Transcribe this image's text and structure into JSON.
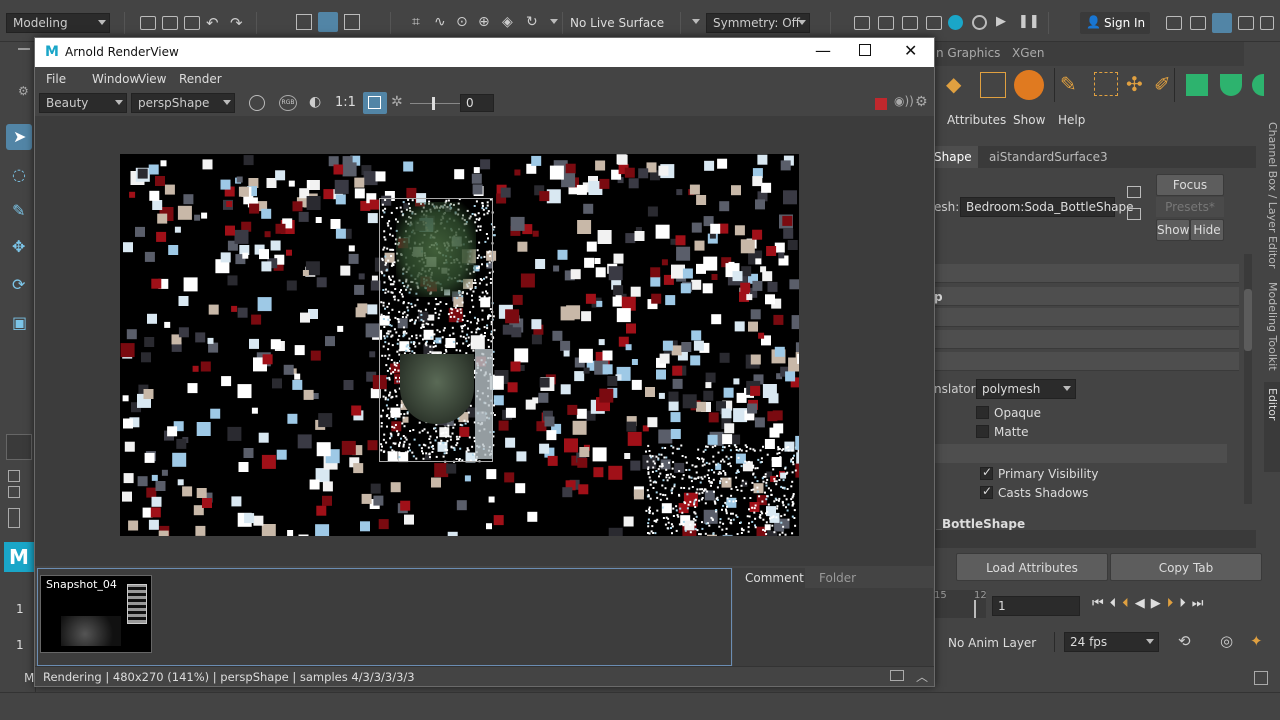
{
  "topbar": {
    "menu_set": "Modeling",
    "live_surface": "No Live Surface",
    "symmetry": "Symmetry: Off",
    "sign_in": "Sign In"
  },
  "arnold": {
    "title": "Arnold RenderView",
    "menu": [
      "File",
      "Window",
      "View",
      "Render"
    ],
    "aov": "Beauty",
    "camera": "perspShape",
    "ratio": "1:1",
    "exposure": "0",
    "snapshot_label": "Snapshot_04",
    "tabs": [
      "Comment",
      "Folder"
    ],
    "status": "Rendering | 480x270 (141%) | perspShape  | samples 4/3/3/3/3/3"
  },
  "right": {
    "tab_partial_1": "n Graphics",
    "tab_xgen": "XGen",
    "menu": [
      "Attributes",
      "Show",
      "Help"
    ],
    "node_tab_1": "Shape",
    "node_tab_2": "aiStandardSurface3",
    "mesh_label": "esh:",
    "mesh_value": "Bedroom:Soda_BottleShape",
    "focus": "Focus",
    "presets": "Presets*",
    "show": "Show",
    "hide": "Hide",
    "section_p": "p",
    "translator_label": "nslator",
    "translator_value": "polymesh",
    "opaque": "Opaque",
    "matte": "Matte",
    "primary_visibility": "Primary Visibility",
    "casts_shadows": "Casts Shadows",
    "node_name": "_BottleShape",
    "load_attributes": "Load Attributes",
    "copy_tab": "Copy Tab",
    "vtab_channel": "Channel Box / Layer Editor",
    "vtab_modeling": "Modeling Toolkit",
    "vtab_attr": "Attribute Editor"
  },
  "timeline": {
    "tick_15": "15",
    "tick_12": "12",
    "frame": "1",
    "anim_layer": "No Anim Layer",
    "fps": "24 fps"
  },
  "leftframes": {
    "f1": "1",
    "f2": "1"
  },
  "bottom": {
    "mel": "M"
  },
  "colors": {
    "accent_blue": "#5285a6",
    "render_bg": "#000000",
    "record_red": "#c0282d"
  }
}
